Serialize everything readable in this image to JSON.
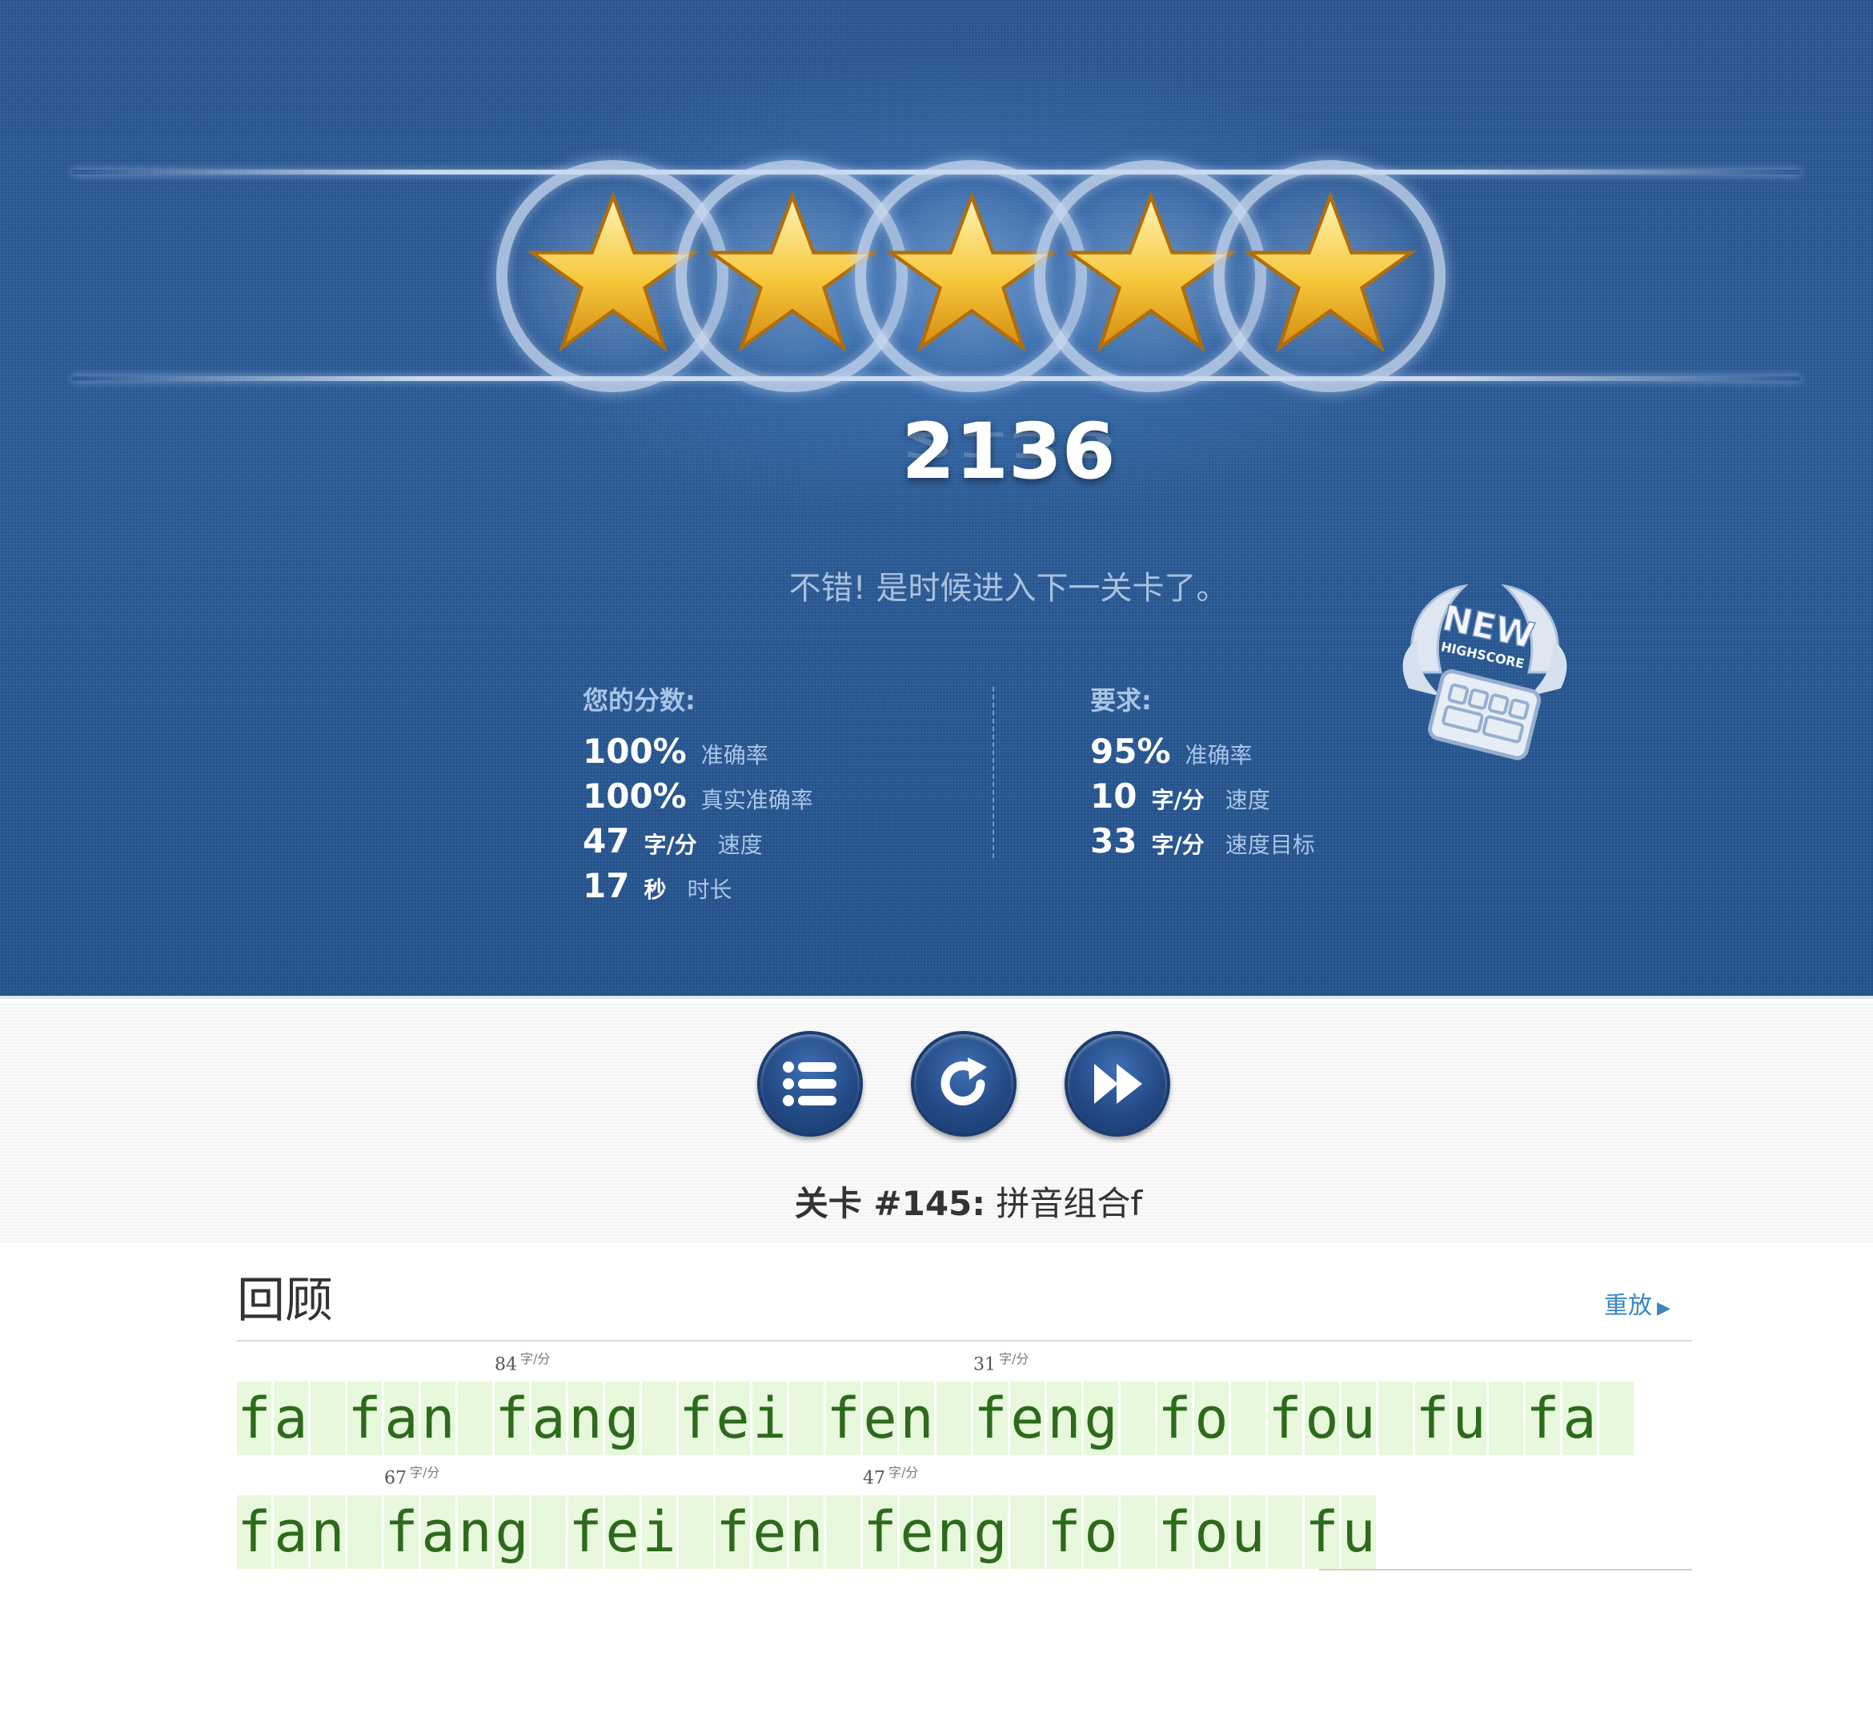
{
  "result": {
    "stars_earned": 5,
    "stars_total": 5,
    "score": "2136",
    "message": "不错! 是时候进入下一关卡了。",
    "badge_text_main": "NEW",
    "badge_text_sub": "HIGHSCORE"
  },
  "your_score": {
    "title": "您的分数:",
    "rows": [
      {
        "value": "100%",
        "unit": "",
        "label": "准确率"
      },
      {
        "value": "100%",
        "unit": "",
        "label": "真实准确率"
      },
      {
        "value": "47",
        "unit": "字/分",
        "label": "速度"
      },
      {
        "value": "17",
        "unit": "秒",
        "label": "时长"
      }
    ]
  },
  "requirements": {
    "title": "要求:",
    "rows": [
      {
        "value": "95%",
        "unit": "",
        "label": "准确率"
      },
      {
        "value": "10",
        "unit": "字/分",
        "label": "速度"
      },
      {
        "value": "33",
        "unit": "字/分",
        "label": "速度目标"
      }
    ]
  },
  "actions": {
    "list_icon": "list-icon",
    "retry_icon": "refresh-icon",
    "next_icon": "fast-forward-icon"
  },
  "level": {
    "prefix": "关卡 #145:",
    "name": "拼音组合f"
  },
  "review": {
    "title": "回顾",
    "replay_label": "重放",
    "speed_unit": "字/分",
    "line1": [
      "fa",
      "fan",
      "fang",
      "fei",
      "fen",
      "feng",
      "fo",
      "fou",
      "fu",
      "fa"
    ],
    "line2": [
      "fan",
      "fang",
      "fei",
      "fen",
      "feng",
      "fo",
      "fou",
      "fu"
    ],
    "speed_markers": [
      {
        "line": 1,
        "word_index": 2,
        "value": "84"
      },
      {
        "line": 1,
        "word_index": 5,
        "value": "31"
      },
      {
        "line": 2,
        "word_index": 1,
        "value": "67"
      },
      {
        "line": 2,
        "word_index": 4,
        "value": "47"
      }
    ]
  },
  "colors": {
    "panel_blue": "#2a5793",
    "typed_text": "#2d6a1c",
    "typed_bg": "#e7f8dc",
    "link_blue": "#3a86c6"
  }
}
